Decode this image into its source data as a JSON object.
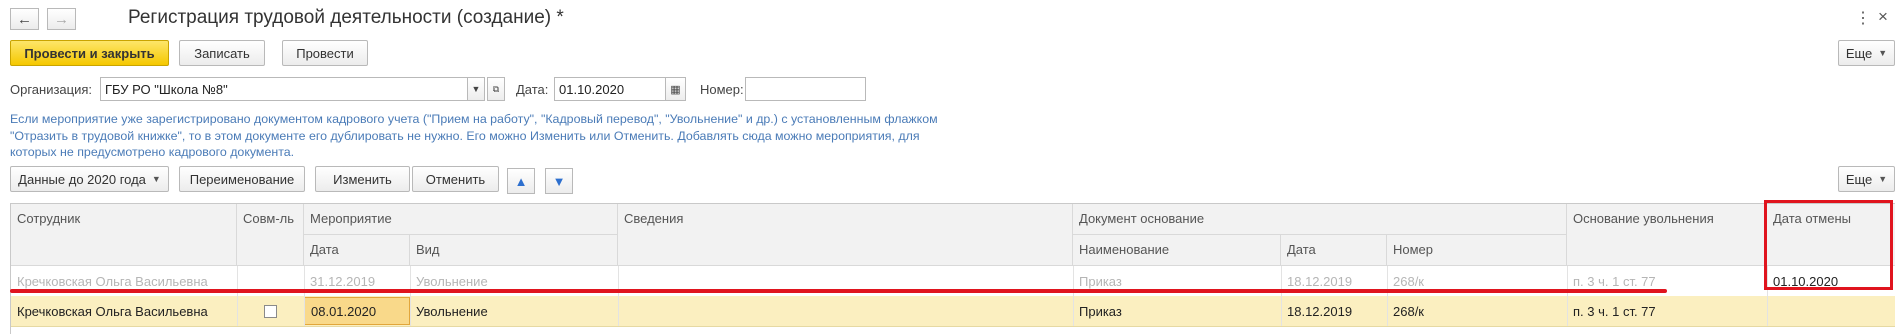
{
  "window": {
    "title": "Регистрация трудовой деятельности (создание) *",
    "menu_icon": "more-vert-icon",
    "close_icon": "close-icon"
  },
  "toolbar": {
    "post_close_label": "Провести и закрыть",
    "save_label": "Записать",
    "post_label": "Провести",
    "more_label": "Еще"
  },
  "header_fields": {
    "org_label": "Организация:",
    "org_value": "ГБУ РО \"Школа №8\"",
    "date_label": "Дата:",
    "date_value": "01.10.2020",
    "number_label": "Номер:",
    "number_value": ""
  },
  "info_text": "Если мероприятие уже зарегистрировано документом кадрового учета (\"Прием на работу\", \"Кадровый перевод\", \"Увольнение\" и др.) с установленным флажком \"Отразить в трудовой книжке\", то в этом документе его дублировать не нужно. Его можно Изменить или Отменить. Добавлять сюда можно мероприятия, для которых не предусмотрено кадрового документа.",
  "table_toolbar": {
    "data_before_label": "Данные до 2020 года",
    "rename_label": "Переименование",
    "change_label": "Изменить",
    "cancel_label": "Отменить",
    "more_label": "Еще"
  },
  "table": {
    "headers": {
      "employee": "Сотрудник",
      "combined": "Совм-ль",
      "event": "Мероприятие",
      "event_date": "Дата",
      "event_kind": "Вид",
      "details": "Сведения",
      "basis_doc": "Документ основание",
      "basis_name": "Наименование",
      "basis_date": "Дата",
      "basis_number": "Номер",
      "dismissal_basis": "Основание увольнения",
      "cancel_date": "Дата отмены"
    },
    "rows": [
      {
        "employee": "Кречковская Ольга Васильевна",
        "combined": false,
        "event_date": "31.12.2019",
        "event_kind": "Увольнение",
        "details": "",
        "basis_name": "Приказ",
        "basis_date": "18.12.2019",
        "basis_number": "268/к",
        "dismissal_basis": "п. 3 ч. 1 ст. 77",
        "cancel_date": "01.10.2020"
      },
      {
        "employee": "Кречковская Ольга Васильевна",
        "combined": false,
        "event_date": "08.01.2020",
        "event_kind": "Увольнение",
        "details": "",
        "basis_name": "Приказ",
        "basis_date": "18.12.2019",
        "basis_number": "268/к",
        "dismissal_basis": "п. 3 ч. 1 ст. 77",
        "cancel_date": ""
      }
    ]
  },
  "colors": {
    "accent_yellow": "#f5c800",
    "info_blue": "#4a7bb7",
    "annotation_red": "#e0141e",
    "selected_row": "#fbefc0"
  }
}
